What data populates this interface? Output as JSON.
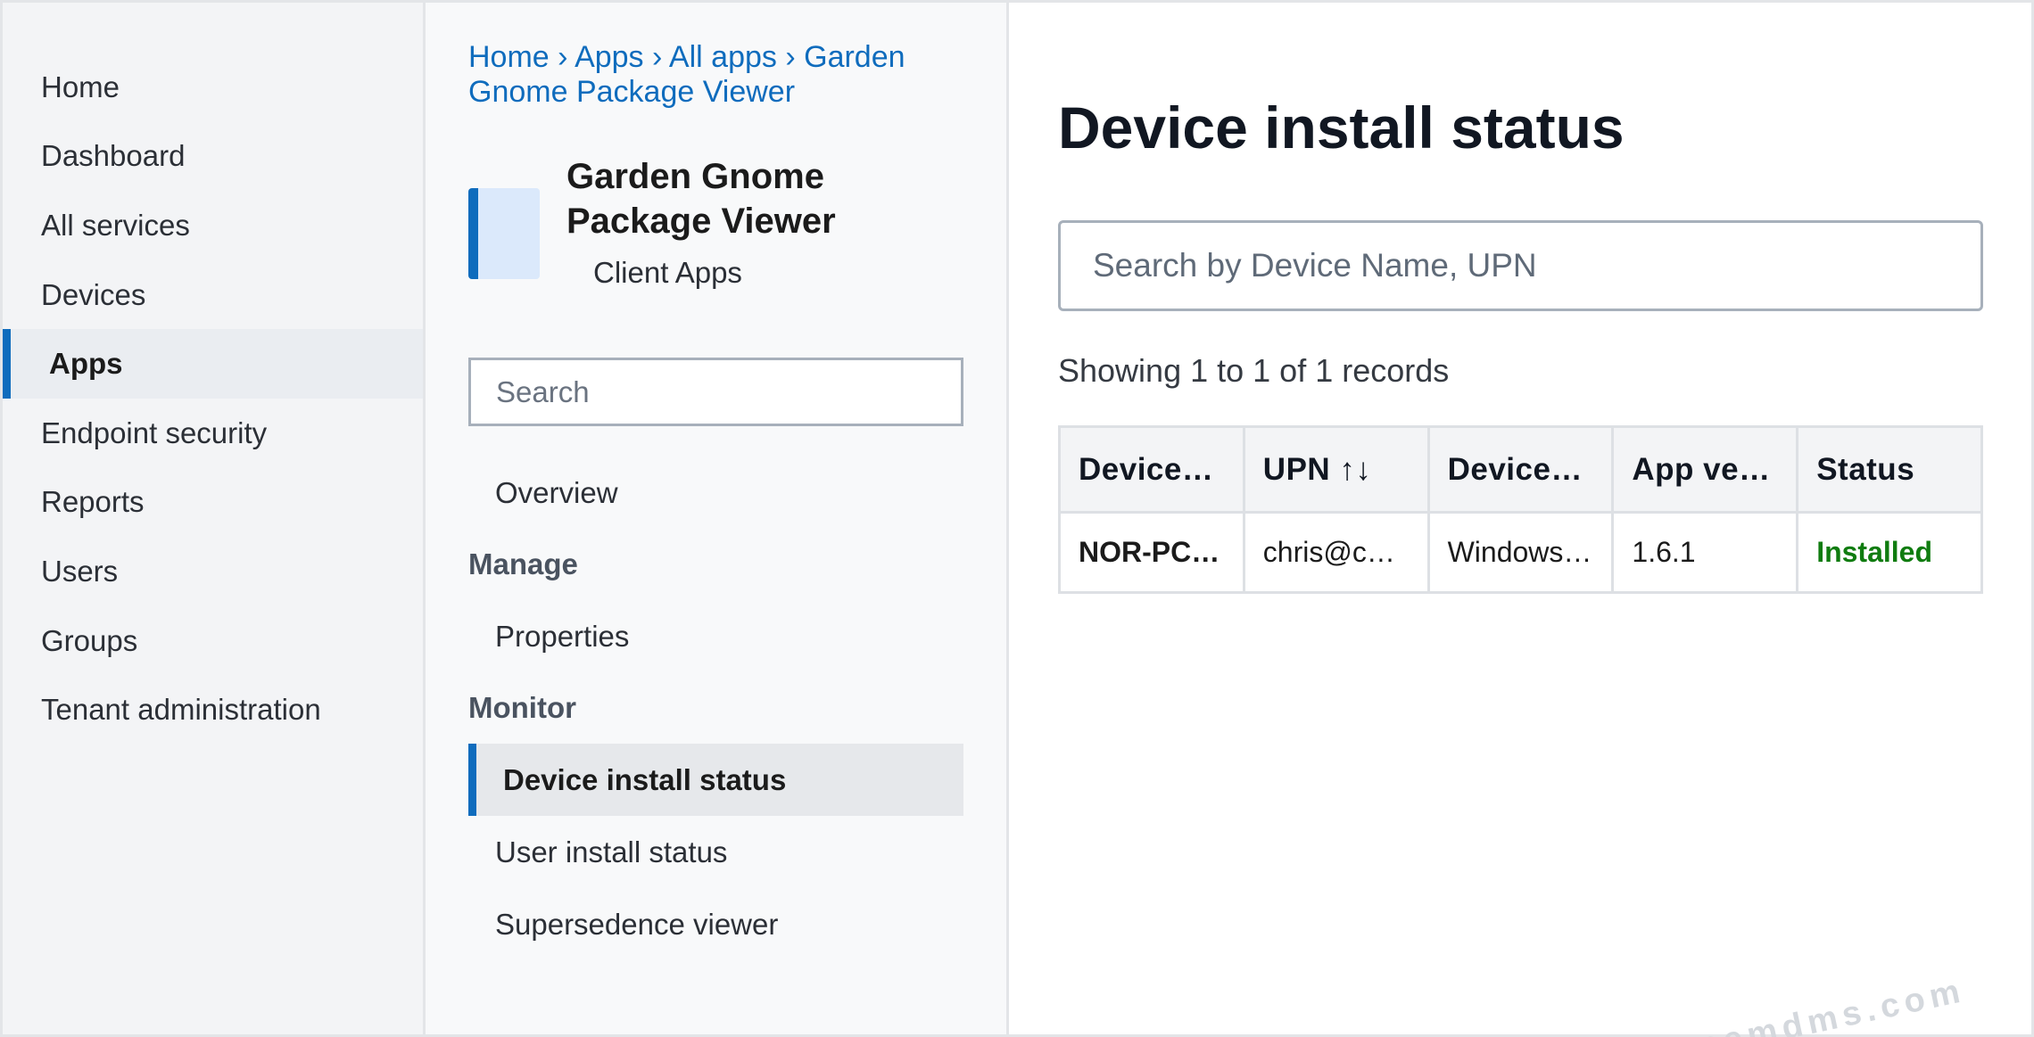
{
  "left_nav": {
    "items": [
      {
        "label": "Home",
        "active": false
      },
      {
        "label": "Dashboard",
        "active": false
      },
      {
        "label": "All services",
        "active": false
      },
      {
        "label": "Devices",
        "active": false
      },
      {
        "label": "Apps",
        "active": true
      },
      {
        "label": "Endpoint security",
        "active": false
      },
      {
        "label": "Reports",
        "active": false
      },
      {
        "label": "Users",
        "active": false
      },
      {
        "label": "Groups",
        "active": false
      },
      {
        "label": "Tenant administration",
        "active": false
      }
    ]
  },
  "blade": {
    "breadcrumb": [
      "Home",
      "Apps",
      "All apps",
      "Garden Gnome Package Viewer"
    ],
    "breadcrumb_separator": "›",
    "app_title": "Garden Gnome Package Viewer",
    "app_subtitle": "Client Apps",
    "search_placeholder": "Search",
    "overview_label": "Overview",
    "manage_section": "Manage",
    "properties_label": "Properties",
    "monitor_section": "Monitor",
    "device_install_status_label": "Device install status",
    "user_install_status_label": "User install status",
    "supersedence_viewer_label": "Supersedence viewer"
  },
  "main": {
    "title": "Device install status",
    "search_placeholder": "Search by Device Name, UPN",
    "records_text": "Showing 1 to 1 of 1 records",
    "columns": [
      "Device…",
      "UPN ↑↓",
      "Device…",
      "App ve…",
      "Status"
    ],
    "rows": [
      [
        "NOR-PC…",
        "chris@c…",
        "Windows…",
        "1.6.1",
        "Installed"
      ]
    ]
  },
  "watermark": "intunemdms.com",
  "colors": {
    "accent": "#0f6cbd",
    "installed": "#107c10",
    "nav_bg": "#f3f4f6"
  }
}
